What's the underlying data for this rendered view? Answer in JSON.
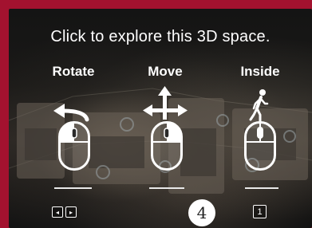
{
  "overlay": {
    "title": "Click to explore this 3D space."
  },
  "controls": [
    {
      "label": "Rotate",
      "gesture_icon": "rotate-arrow-icon",
      "mouse_button": "left"
    },
    {
      "label": "Move",
      "gesture_icon": "move-arrows-icon",
      "mouse_button": "right"
    },
    {
      "label": "Inside",
      "gesture_icon": "walking-person-icon",
      "mouse_button": "scroll"
    }
  ],
  "keyboard": {
    "rotate_keys": [
      "◂",
      "▸"
    ],
    "move_key": "4",
    "inside_key": "1"
  },
  "colors": {
    "frame_border": "#a3122f",
    "text": "#ffffff"
  }
}
